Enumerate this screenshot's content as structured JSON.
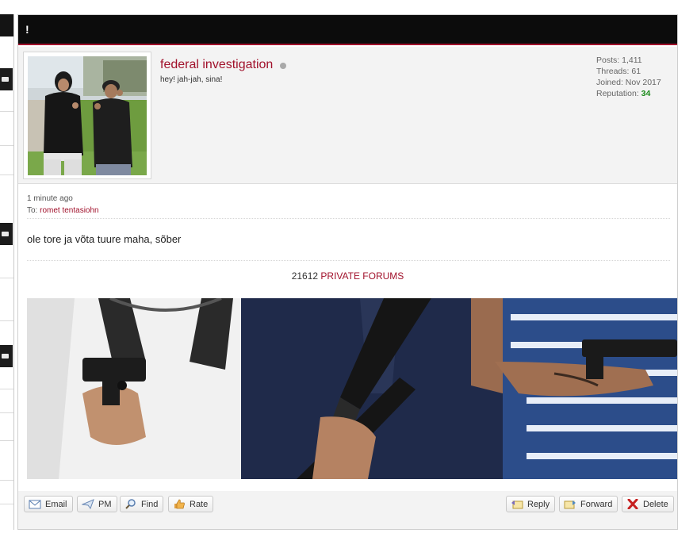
{
  "post": {
    "header_text": "!",
    "author": {
      "username": "federal investigation",
      "status": "offline",
      "usertitle": "hey! jah-jah, sina!",
      "stats": {
        "posts_label": "Posts:",
        "posts": "1,411",
        "threads_label": "Threads:",
        "threads": "61",
        "joined_label": "Joined:",
        "joined": "Nov 2017",
        "reputation_label": "Reputation:",
        "reputation": "34"
      }
    },
    "time": "1 minute ago",
    "to_label": "To:",
    "to_user": "romet tentasiohn",
    "message": "ole tore ja võta tuure maha, sõber",
    "signature": {
      "number": "21612",
      "link": "PRIVATE FORUMS"
    }
  },
  "footer": {
    "left": [
      "Email",
      "PM",
      "Find",
      "Rate"
    ],
    "right": [
      "Reply",
      "Forward",
      "Delete"
    ]
  },
  "colors": {
    "accent": "#a1112b",
    "header_bg": "#0c0c0c",
    "reputation": "#1a8a1a"
  }
}
